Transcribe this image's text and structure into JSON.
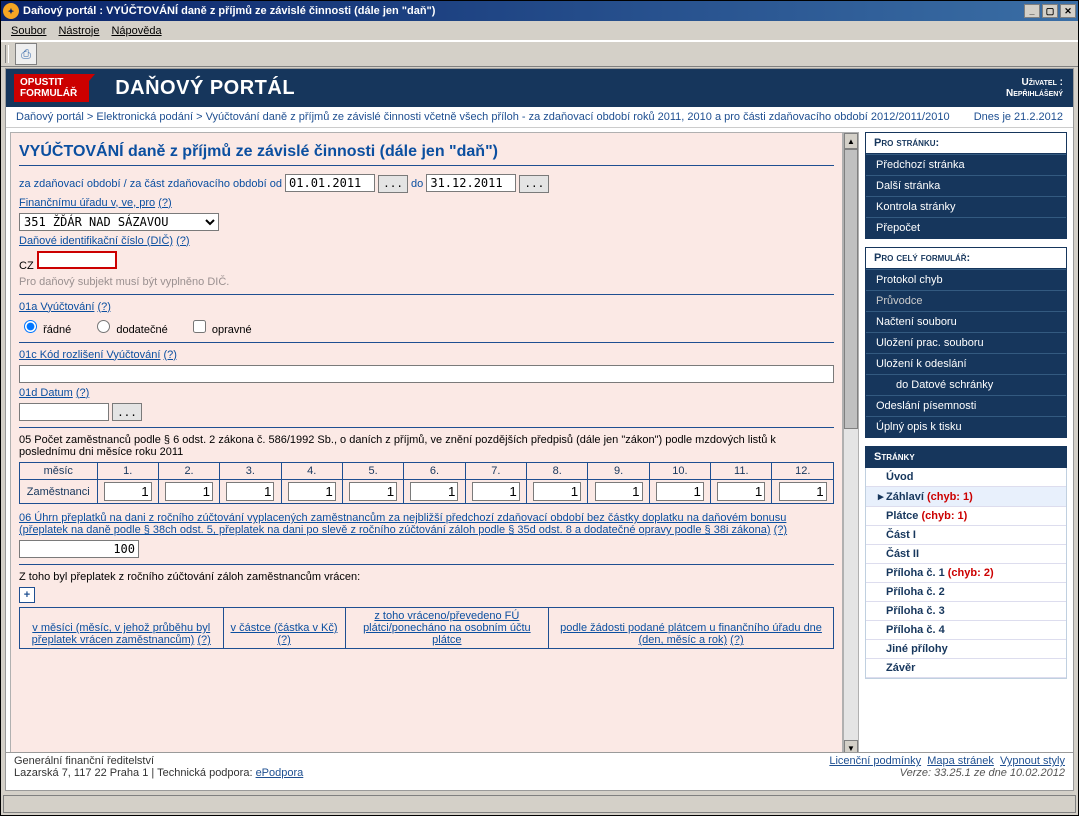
{
  "window": {
    "title": "Daňový portál : VYÚČTOVÁNÍ daně z příjmů ze závislé činnosti (dále jen \"daň\")"
  },
  "menu": {
    "file": "Soubor",
    "tools": "Nástroje",
    "help": "Nápověda"
  },
  "portal": {
    "leave_line1": "OPUSTIT",
    "leave_line2": "FORMULÁŘ",
    "title": "DAŇOVÝ PORTÁL",
    "user_label": "Uživatel :",
    "user_status": "Nepřihlášený"
  },
  "breadcrumb": {
    "p1": "Daňový portál",
    "p2": "Elektronická podání",
    "p3": "Vyúčtování daně z příjmů ze závislé činnosti včetně všech příloh - za zdaňovací období roků 2011, 2010 a pro části zdaňovacího období 2012/2011/2010",
    "date": "Dnes je 21.2.2012"
  },
  "form": {
    "title": "VYÚČTOVÁNÍ daně z příjmů ze závislé činnosti (dále jen \"daň\")",
    "period_lbl": "za zdaňovací období / za část zdaňovacího období od",
    "period_from": "01.01.2011",
    "period_to_lbl": "do",
    "period_to": "31.12.2011",
    "fu_link": "Finančnímu úřadu v, ve, pro",
    "fu_value": "351 ŽĎÁR NAD SÁZAVOU",
    "dic_link": "Daňové identifikační číslo (DIČ)",
    "cz": "CZ",
    "dic_hint": "Pro daňový subjekt musí být vyplněno DIČ.",
    "vyuct_link": "01a Vyúčtování",
    "radio_radne": "řádné",
    "radio_dodat": "dodatečné",
    "chk_opravne": "opravné",
    "kod_link": "01c Kód rozlišení Vyúčtování",
    "datum_link": "01d Datum",
    "t05": "05 Počet zaměstnanců podle § 6 odst. 2 zákona č. 586/1992 Sb., o daních z příjmů, ve znění pozdějších předpisů (dále jen \"zákon\") podle mzdových listů k poslednímu dni měsíce roku 2011",
    "months": [
      "měsíc",
      "1.",
      "2.",
      "3.",
      "4.",
      "5.",
      "6.",
      "7.",
      "8.",
      "9.",
      "10.",
      "11.",
      "12."
    ],
    "emp_lbl": "Zaměstnanci",
    "emp": [
      "1",
      "1",
      "1",
      "1",
      "1",
      "1",
      "1",
      "1",
      "1",
      "1",
      "1",
      "1"
    ],
    "t06": "06 Úhrn přeplatků na dani z ročního zúčtování vyplacených zaměstnancům za nejbližší předchozí zdaňovací období bez částky doplatku na daňovém bonusu (přeplatek na daně podle § 38ch odst. 5, přeplatek na dani po slevě z ročního zúčtování záloh podle § 35d odst. 8 a dodatečné opravy podle § 38i zákona)",
    "t06_val": "100",
    "t06b": "Z toho byl přeplatek z ročního zúčtování záloh zaměstnancům vrácen:",
    "col1": "v měsíci (měsíc, v jehož průběhu byl přeplatek vrácen zaměstnancům)",
    "col2": "v částce (částka v Kč)",
    "col3": "z toho vráceno/převedeno FÚ plátci/ponecháno na osobním účtu plátce",
    "col4": "podle žádosti podané plátcem u finančního úřadu dne (den, měsíc a rok)",
    "q": "(?)",
    "dots": "..."
  },
  "sidebar": {
    "page_head": "Pro stránku:",
    "page_items": [
      "Předchozí stránka",
      "Další stránka",
      "Kontrola stránky",
      "Přepočet"
    ],
    "form_head": "Pro celý formulář:",
    "form_items": [
      "Protokol chyb",
      "Průvodce",
      "Načtení souboru",
      "Uložení prac. souboru",
      "Uložení k odeslání",
      "do Datové schránky",
      "Odeslání písemnosti",
      "Úplný opis k tisku"
    ],
    "pages_head": "Stránky",
    "pages": [
      {
        "label": "Úvod",
        "err": ""
      },
      {
        "label": "Záhlaví",
        "err": "(chyb: 1)",
        "active": true,
        "marker": "▸"
      },
      {
        "label": "Plátce",
        "err": "(chyb: 1)"
      },
      {
        "label": "Část I",
        "err": ""
      },
      {
        "label": "Část II",
        "err": ""
      },
      {
        "label": "Příloha č. 1",
        "err": "(chyb: 2)"
      },
      {
        "label": "Příloha č. 2",
        "err": ""
      },
      {
        "label": "Příloha č. 3",
        "err": ""
      },
      {
        "label": "Příloha č. 4",
        "err": ""
      },
      {
        "label": "Jiné přílohy",
        "err": ""
      },
      {
        "label": "Závěr",
        "err": ""
      }
    ]
  },
  "footer": {
    "org": "Generální finanční ředitelství",
    "addr": "Lazarská 7, 117 22 Praha 1 | Technická podpora: ",
    "support": "ePodpora",
    "links": [
      "Licenční podmínky",
      "Mapa stránek",
      "Vypnout styly"
    ],
    "version": "Verze: 33.25.1 ze dne 10.02.2012"
  }
}
